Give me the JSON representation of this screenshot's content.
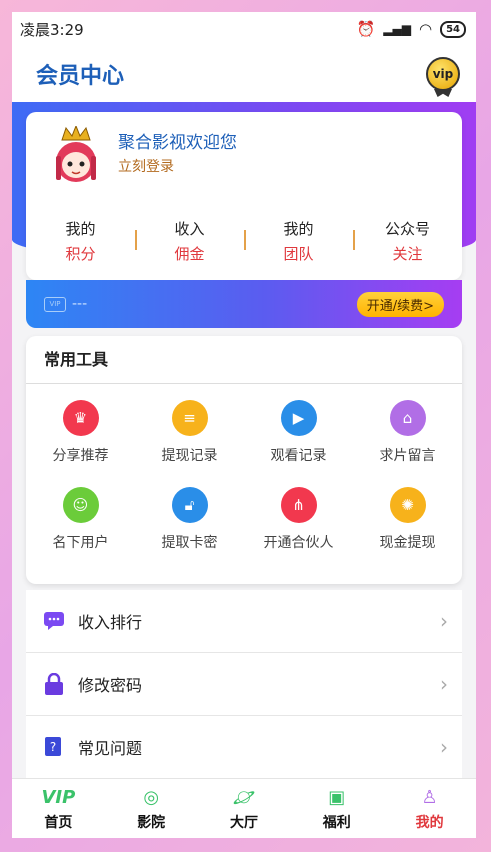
{
  "status": {
    "time": "凌晨3:29",
    "battery": "54"
  },
  "header": {
    "title": "会员中心",
    "vip_badge": "vip"
  },
  "profile": {
    "welcome": "聚合影视欢迎您",
    "login": "立刻登录",
    "stats": [
      {
        "top": "我的",
        "bottom": "积分"
      },
      {
        "top": "收入",
        "bottom": "佣金"
      },
      {
        "top": "我的",
        "bottom": "团队"
      },
      {
        "top": "公众号",
        "bottom": "关注"
      }
    ]
  },
  "vip_bar": {
    "card_label": "VIP",
    "status": "---",
    "button": "开通/续费>"
  },
  "tools": {
    "title": "常用工具",
    "items": [
      {
        "label": "分享推荐",
        "icon": "crown-icon",
        "color": "#f2384e"
      },
      {
        "label": "提现记录",
        "icon": "coins-icon",
        "color": "#f7b21b"
      },
      {
        "label": "观看记录",
        "icon": "play-icon",
        "color": "#2a8ee8"
      },
      {
        "label": "求片留言",
        "icon": "store-icon",
        "color": "#b16ee6"
      },
      {
        "label": "名下用户",
        "icon": "contact-icon",
        "color": "#6bcc3a"
      },
      {
        "label": "提取卡密",
        "icon": "lock-icon",
        "color": "#2a8ee8"
      },
      {
        "label": "开通合伙人",
        "icon": "network-icon",
        "color": "#f2384e"
      },
      {
        "label": "现金提现",
        "icon": "gear-icon",
        "color": "#f7b21b"
      }
    ]
  },
  "list": [
    {
      "label": "收入排行",
      "icon": "message-icon",
      "color": "#7b4af2"
    },
    {
      "label": "修改密码",
      "icon": "padlock-icon",
      "color": "#6a3be0"
    },
    {
      "label": "常见问题",
      "icon": "question-icon",
      "color": "#3b49d8"
    }
  ],
  "tabbar": [
    {
      "label": "首页",
      "icon": "vip-text-icon",
      "active": false
    },
    {
      "label": "影院",
      "icon": "film-reel-icon",
      "active": false
    },
    {
      "label": "大厅",
      "icon": "planet-icon",
      "active": false
    },
    {
      "label": "福利",
      "icon": "gift-icon",
      "active": false
    },
    {
      "label": "我的",
      "icon": "person-icon",
      "active": true
    }
  ]
}
